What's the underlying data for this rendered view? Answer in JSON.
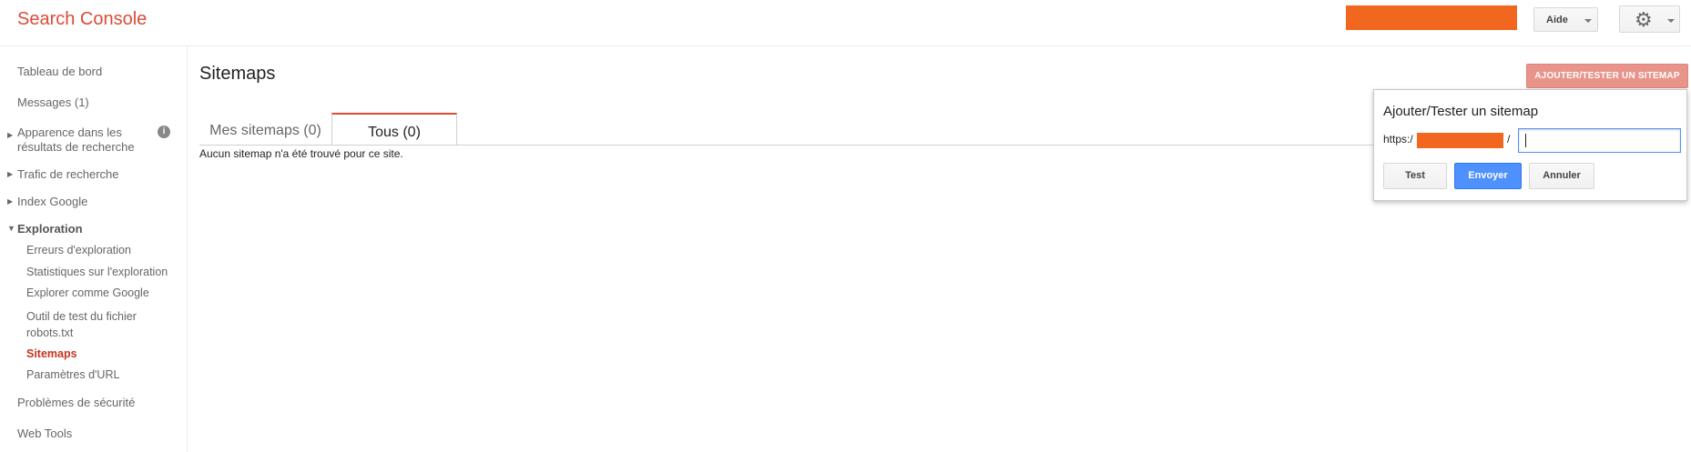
{
  "header": {
    "logo": "Search Console",
    "help_label": "Aide",
    "settings_icon": "gear-icon"
  },
  "sidebar": {
    "items": [
      {
        "label": "Tableau de bord"
      },
      {
        "label": "Messages (1)"
      },
      {
        "label_line1": "Apparence dans les",
        "label_line2": "résultats de recherche"
      },
      {
        "label": "Trafic de recherche"
      },
      {
        "label": "Index Google"
      },
      {
        "label": "Exploration"
      },
      {
        "label": "Problèmes de sécurité"
      },
      {
        "label": "Web Tools"
      }
    ],
    "exploration_subitems": [
      {
        "label": "Erreurs d'exploration"
      },
      {
        "label": "Statistiques sur l'exploration"
      },
      {
        "label": "Explorer comme Google"
      },
      {
        "label_line1": "Outil de test du fichier",
        "label_line2": "robots.txt"
      },
      {
        "label": "Sitemaps"
      },
      {
        "label": "Paramètres d'URL"
      }
    ]
  },
  "main": {
    "title": "Sitemaps",
    "add_button_label": "AJOUTER/TESTER UN SITEMAP",
    "tabs": [
      {
        "label": "Mes sitemaps (0)"
      },
      {
        "label": "Tous (0)"
      }
    ],
    "empty_message": "Aucun sitemap n'a été trouvé pour ce site."
  },
  "popup": {
    "title": "Ajouter/Tester un sitemap",
    "url_prefix": "https:/",
    "url_suffix": "/",
    "input_value": "",
    "buttons": {
      "test": "Test",
      "send": "Envoyer",
      "cancel": "Annuler"
    }
  },
  "colors": {
    "brand_red": "#dd4b39",
    "redaction_orange": "#f2671f",
    "primary_blue": "#4d90fe",
    "add_button_bg": "#e8948a"
  }
}
